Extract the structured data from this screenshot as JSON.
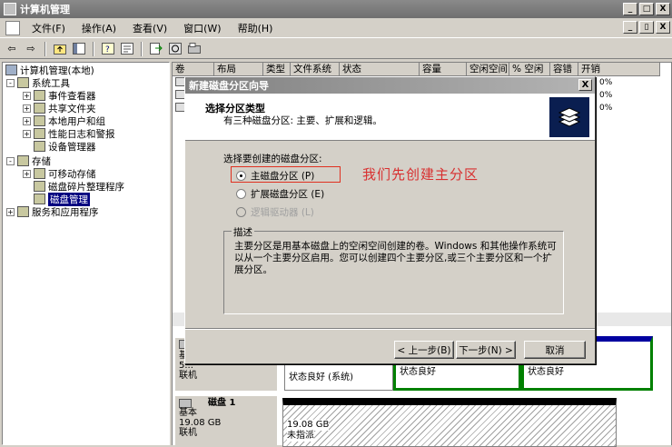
{
  "window": {
    "title": "计算机管理",
    "min": "_",
    "max": "□",
    "close": "X"
  },
  "menu": {
    "items": [
      "文件(F)",
      "操作(A)",
      "查看(V)",
      "窗口(W)",
      "帮助(H)"
    ],
    "min": "_",
    "restore": "▯",
    "close": "X"
  },
  "toolbar": {
    "back": "⇦",
    "forward": "⇨"
  },
  "tree": {
    "root": "计算机管理(本地)",
    "items": [
      {
        "label": "系统工具",
        "level": 1,
        "exp": "-"
      },
      {
        "label": "事件查看器",
        "level": 2,
        "exp": "+"
      },
      {
        "label": "共享文件夹",
        "level": 2,
        "exp": "+"
      },
      {
        "label": "本地用户和组",
        "level": 2,
        "exp": "+"
      },
      {
        "label": "性能日志和警报",
        "level": 2,
        "exp": "+"
      },
      {
        "label": "设备管理器",
        "level": 2,
        "exp": ""
      },
      {
        "label": "存储",
        "level": 1,
        "exp": "-"
      },
      {
        "label": "可移动存储",
        "level": 2,
        "exp": "+"
      },
      {
        "label": "磁盘碎片整理程序",
        "level": 2,
        "exp": ""
      },
      {
        "label": "磁盘管理",
        "level": 2,
        "exp": "",
        "selected": true
      },
      {
        "label": "服务和应用程序",
        "level": 1,
        "exp": "+"
      }
    ]
  },
  "volumes": {
    "columns": [
      "卷",
      "布局",
      "类型",
      "文件系统",
      "状态",
      "容量",
      "空闲空间",
      "% 空闲",
      "容错",
      "开销"
    ],
    "pct": [
      "0%",
      "0%",
      "0%"
    ]
  },
  "graph": {
    "disk0": {
      "line1": "基",
      "line2": "5...",
      "line3": "联机"
    },
    "disk0_parts": [
      {
        "l1": "状态良好 (系统)"
      },
      {
        "l1": "状态良好"
      },
      {
        "l1": "状态良好"
      }
    ],
    "disk1": {
      "name": "磁盘 1",
      "type": "基本",
      "size": "19.08 GB",
      "status": "联机"
    },
    "disk1_part": {
      "size": "19.08 GB",
      "status": "未指派"
    }
  },
  "dialog": {
    "title": "新建磁盘分区向导",
    "close": "X",
    "heading": "选择分区类型",
    "subheading": "有三种磁盘分区: 主要、扩展和逻辑。",
    "prompt": "选择要创建的磁盘分区:",
    "options": [
      {
        "label": "主磁盘分区 (P)",
        "checked": true,
        "enabled": true
      },
      {
        "label": "扩展磁盘分区 (E)",
        "checked": false,
        "enabled": true
      },
      {
        "label": "逻辑驱动器 (L)",
        "checked": false,
        "enabled": false
      }
    ],
    "annotation": "我们先创建主分区",
    "group_label": "描述",
    "description": "主要分区是用基本磁盘上的空闲空间创建的卷。Windows 和其他操作系统可以从一个主要分区启用。您可以创建四个主要分区,或三个主要分区和一个扩展分区。",
    "buttons": {
      "back": "< 上一步(B)",
      "next": "下一步(N) >",
      "cancel": "取消"
    }
  }
}
